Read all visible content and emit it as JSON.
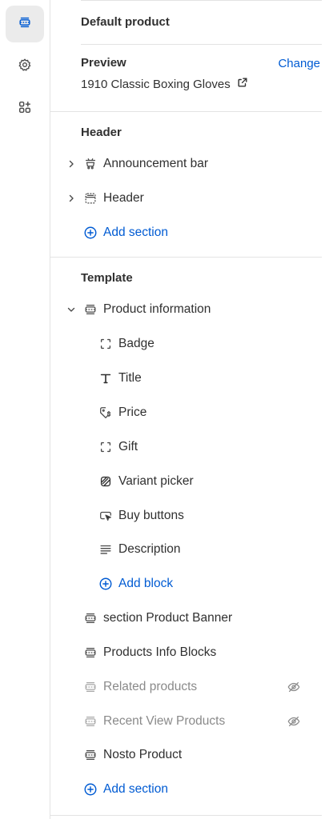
{
  "rail": {
    "items": [
      {
        "name": "sections",
        "active": true
      },
      {
        "name": "settings",
        "active": false
      },
      {
        "name": "apps",
        "active": false
      }
    ]
  },
  "panel": {
    "page_title": "Default product",
    "preview": {
      "label": "Preview",
      "change_label": "Change",
      "value": "1910 Classic Boxing Gloves"
    },
    "header_group": {
      "title": "Header",
      "sections": [
        {
          "label": "Announcement bar",
          "icon": "announcement-icon"
        },
        {
          "label": "Header",
          "icon": "header-section-icon"
        }
      ],
      "add_label": "Add section"
    },
    "template_group": {
      "title": "Template",
      "product_info": {
        "label": "Product information",
        "blocks": [
          {
            "label": "Badge",
            "icon": "dashed-square-icon"
          },
          {
            "label": "Title",
            "icon": "text-title-icon"
          },
          {
            "label": "Price",
            "icon": "price-tag-icon"
          },
          {
            "label": "Gift",
            "icon": "dashed-square-icon"
          },
          {
            "label": "Variant picker",
            "icon": "variant-icon"
          },
          {
            "label": "Buy buttons",
            "icon": "cursor-click-icon"
          },
          {
            "label": "Description",
            "icon": "text-lines-icon"
          }
        ],
        "add_block_label": "Add block"
      },
      "sections": [
        {
          "label": "section Product Banner",
          "hidden": false
        },
        {
          "label": "Products Info Blocks",
          "hidden": false
        },
        {
          "label": "Related products",
          "hidden": true
        },
        {
          "label": "Recent View Products",
          "hidden": true
        },
        {
          "label": "Nosto Product",
          "hidden": false
        }
      ],
      "add_label": "Add section"
    }
  },
  "colors": {
    "link": "#005bd3",
    "text": "#303030",
    "muted": "#8a8a8a",
    "divider": "#e3e3e3",
    "rail_active": "#ebebeb"
  }
}
